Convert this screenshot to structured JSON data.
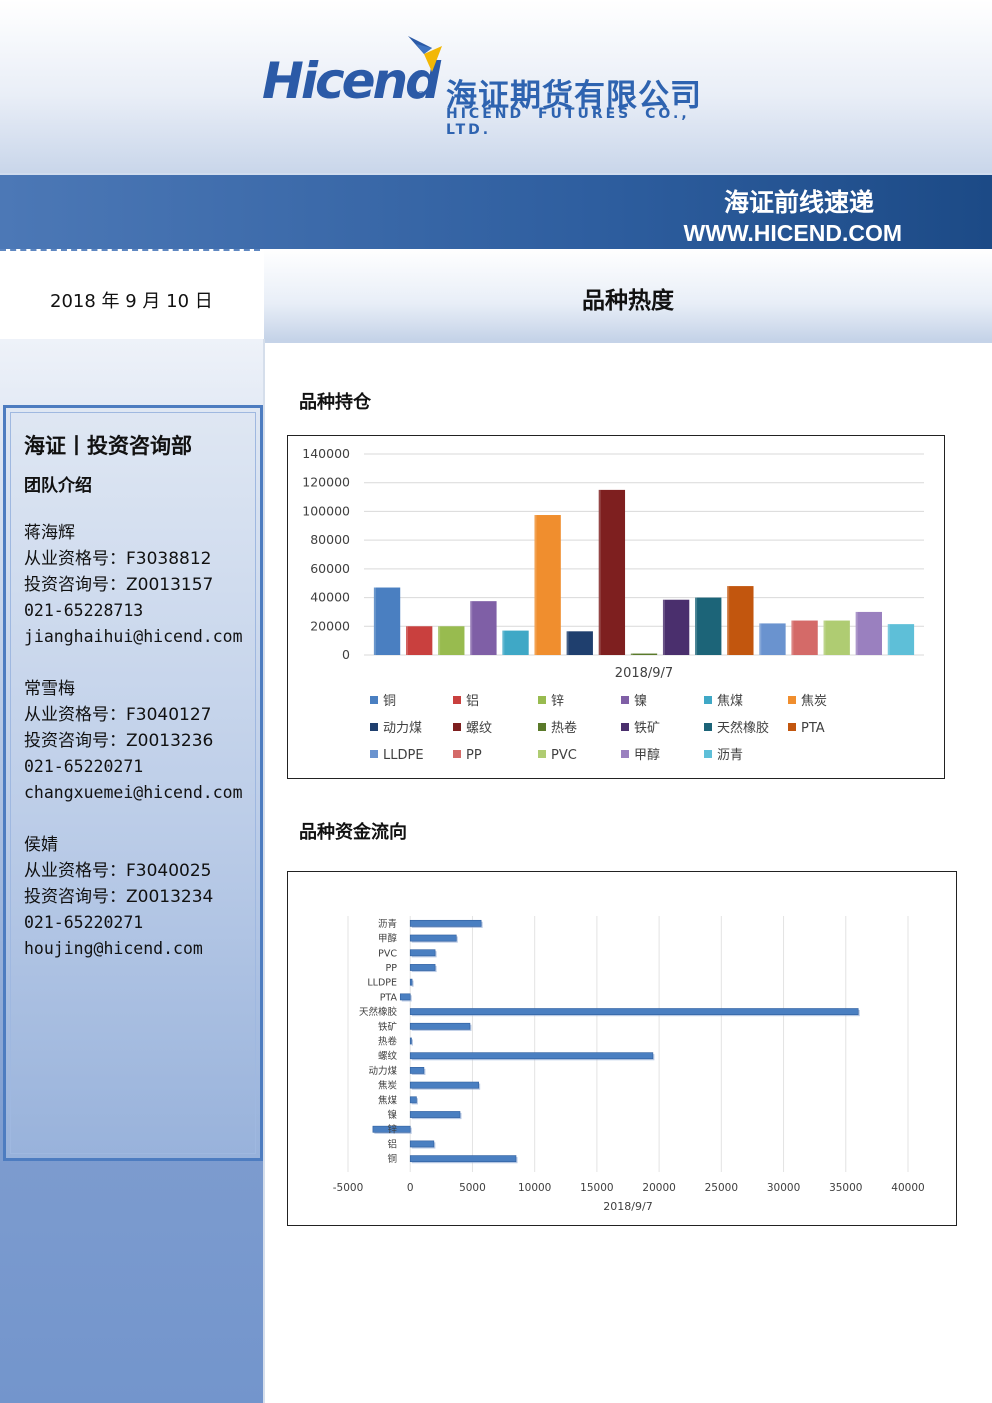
{
  "header": {
    "logo_en": "Hicend",
    "logo_registered": "®",
    "logo_cn": "海证期货有限公司",
    "logo_cn_en": "HICEND FUTURES CO., LTD.",
    "band_title": "海证前线速递",
    "band_url": "WWW.HICEND.COM"
  },
  "date": "2018 年 9 月 10 日",
  "section_title": "品种热度",
  "sidebar": {
    "title": "海证丨投资咨询部",
    "subtitle": "团队介绍",
    "members": [
      {
        "name": "蒋海辉",
        "qualification": "从业资格号：F3038812",
        "consult": "投资咨询号：Z0013157",
        "phone": "021-65228713",
        "email": "jianghaihui@hicend.com"
      },
      {
        "name": "常雪梅",
        "qualification": "从业资格号：F3040127",
        "consult": "投资咨询号：Z0013236",
        "phone": "021-65220271",
        "email": "changxuemei@hicend.com"
      },
      {
        "name": "侯婧",
        "qualification": "从业资格号：F3040025",
        "consult": "投资咨询号：Z0013234",
        "phone": "021-65220271",
        "email": "houjing@hicend.com"
      }
    ]
  },
  "charts": {
    "holdings_heading": "品种持仓",
    "flow_heading": "品种资金流向"
  },
  "chart_data": [
    {
      "type": "bar",
      "title": "",
      "category": "2018/9/7",
      "ylim": [
        0,
        140000
      ],
      "yticks": [
        0,
        20000,
        40000,
        60000,
        80000,
        100000,
        120000,
        140000
      ],
      "grid": true,
      "legend_position": "bottom",
      "series": [
        {
          "name": "铜",
          "value": 47000,
          "color": "#4a7fc1"
        },
        {
          "name": "铝",
          "value": 20000,
          "color": "#c9403e"
        },
        {
          "name": "锌",
          "value": 20000,
          "color": "#98bb4f"
        },
        {
          "name": "镍",
          "value": 37500,
          "color": "#7f5fa6"
        },
        {
          "name": "焦煤",
          "value": 17000,
          "color": "#3fa8c6"
        },
        {
          "name": "焦炭",
          "value": 97500,
          "color": "#f08e2e"
        },
        {
          "name": "动力煤",
          "value": 16500,
          "color": "#1f3f6e"
        },
        {
          "name": "螺纹",
          "value": 115000,
          "color": "#7e1f1f"
        },
        {
          "name": "热卷",
          "value": 1000,
          "color": "#5a7a2a"
        },
        {
          "name": "铁矿",
          "value": 38500,
          "color": "#4a2f6d"
        },
        {
          "name": "天然橡胶",
          "value": 40000,
          "color": "#1c6478"
        },
        {
          "name": "PTA",
          "value": 48000,
          "color": "#c2560e"
        },
        {
          "name": "LLDPE",
          "value": 22000,
          "color": "#6a93cf"
        },
        {
          "name": "PP",
          "value": 24000,
          "color": "#d46a68"
        },
        {
          "name": "PVC",
          "value": 24000,
          "color": "#afcc72"
        },
        {
          "name": "甲醇",
          "value": 30000,
          "color": "#9a80bf"
        },
        {
          "name": "沥青",
          "value": 21500,
          "color": "#5ebfd8"
        }
      ]
    },
    {
      "type": "bar",
      "orientation": "horizontal",
      "title": "",
      "xlabel": "2018/9/7",
      "xlim": [
        -5000,
        40000
      ],
      "xticks": [
        -5000,
        0,
        5000,
        10000,
        15000,
        20000,
        25000,
        30000,
        35000,
        40000
      ],
      "grid": true,
      "bar_color": "#4a7fc1",
      "categories": [
        "铜",
        "铝",
        "锌",
        "镍",
        "焦煤",
        "焦炭",
        "动力煤",
        "螺纹",
        "热卷",
        "铁矿",
        "天然橡胶",
        "PTA",
        "LLDPE",
        "PP",
        "PVC",
        "甲醇",
        "沥青"
      ],
      "values": [
        8500,
        1900,
        -3000,
        4000,
        500,
        5500,
        1100,
        19500,
        100,
        4800,
        36000,
        -800,
        150,
        2000,
        2000,
        3700,
        5700
      ]
    }
  ]
}
